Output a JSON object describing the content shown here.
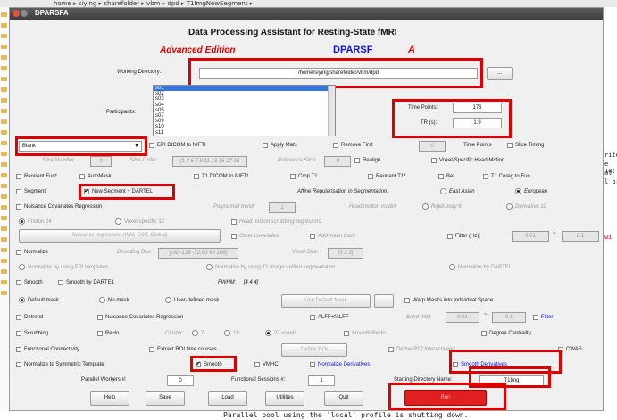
{
  "pathbar": {
    "path": [
      "home",
      "siying",
      "sharefolder",
      "vbm",
      "dpd",
      "T1ImgNewSegment"
    ]
  },
  "window": {
    "title": "DPARSFA"
  },
  "header": {
    "title": "Data Processing Assistant for Resting-State fMRI",
    "subtitle": "Advanced Edition",
    "brand": "DPARSF",
    "brand_suffix": "A"
  },
  "working_dir": {
    "label": "Working Directory:",
    "value": "/home/siying/sharefolder/vbm/dpd",
    "browse": "..."
  },
  "participants": {
    "label": "Participants:",
    "items": [
      "s01",
      "s02",
      "s03",
      "s04",
      "s05",
      "s07",
      "s09",
      "s10",
      "s11"
    ],
    "selected": "s01"
  },
  "time_points": {
    "label": "Time Points:",
    "value": "176"
  },
  "tr": {
    "label": "TR (s):",
    "value": "1.9"
  },
  "template_select": {
    "value": "Blank",
    "arrow": "▼"
  },
  "row_epi": {
    "epi_dicom": "EPI DICOM to NIFTI",
    "apply_mats": "Apply Mats",
    "remove_first": "Remove First",
    "remove_first_value": "0",
    "time_points": "Time Points",
    "slice_timing": "Slice Timing"
  },
  "row_slice": {
    "slice_number": "Slice Number",
    "slice_number_value": "0",
    "slice_order": "Slice Order:",
    "slice_order_value": "[1 3 5 7 9 11 13 15 17 15",
    "reference_slice": "Reference Slice:",
    "reference_slice_value": "0",
    "realign": "Realign",
    "voxel_specific": "Voxel-Specific Head Motion"
  },
  "row_reorient": {
    "reorient_fun": "Reorient Fun*",
    "automask": "AutoMask",
    "t1_dicom": "T1 DICOM to NIFTI",
    "crop_t1": "Crop T1",
    "reorient_t1": "Reorient T1*",
    "bet": "Bet",
    "t1_coreg": "T1 Coreg to Fun"
  },
  "row_segment": {
    "segment": "Segment",
    "new_segment": "New Segment + DARTEL",
    "affine_label": "Affine Regularisation in Segmentation:",
    "east_asian": "East Asian",
    "european": "European"
  },
  "row_nuisance": {
    "nuisance": "Nuisance Covariates Regression",
    "poly_trend": "Polynomial trend:",
    "poly_value": "1",
    "head_motion": "Head motion model:",
    "rigid": "Rigid-body 6",
    "derivative": "Derivative 12"
  },
  "row_friston": {
    "friston": "Friston 24",
    "voxel_12": "Voxel-specific 12",
    "scrubbing_regressors": "Head motion scrubbing regressors"
  },
  "row_regressors": {
    "regressors_btn": "Nuisance regressors (WM, CSF, Global)",
    "other_cov": "Other covariates",
    "add_mean": "Add mean back",
    "filter": "Filter (Hz):",
    "filter_low": "0.01",
    "tilde": "~",
    "filter_high": "0.1"
  },
  "row_normalize": {
    "normalize": "Normalize",
    "bbox_label": "Bounding Box:",
    "bbox_value": "[-90 -126 -72;90 90 108]",
    "voxel_size_label": "Voxel Size:",
    "voxel_size_value": "[3 3 3]"
  },
  "row_norm_opts": {
    "epi_templates": "Normalize by using EPI templates",
    "t1_unified": "Normalize by using T1 image unified segmentation",
    "by_dartel": "Normalize by DARTEL"
  },
  "row_smooth": {
    "smooth": "Smooth",
    "smooth_dartel": "Smooth by DARTEL",
    "fwhm_label": "FWHM:",
    "fwhm_value": "[4 4 4]"
  },
  "row_mask": {
    "default_mask": "Default mask",
    "no_mask": "No mask",
    "user_mask": "User-defined mask",
    "use_default_btn": "Use Default Mask",
    "browse": "...",
    "warp": "Warp Masks into Individual Space"
  },
  "row_detrend": {
    "detrend": "Detrend",
    "nuisance_reg": "Nuisance Covariates Regression",
    "alff": "ALFF+fALFF",
    "band": "Band (Hz):",
    "band_low": "0.01",
    "tilde": "~",
    "band_high": "0.1",
    "filter": "Filter"
  },
  "row_scrubbing": {
    "scrubbing": "Scrubbing",
    "reho": "ReHo",
    "cluster": "Cluster:",
    "c7": "7",
    "c19": "19",
    "c27": "27 voxels",
    "smooth_reho": "Smooth ReHo",
    "degree": "Degree Centrality"
  },
  "row_fc": {
    "fc": "Functional Connectivity",
    "extract_roi": "Extract ROI time courses",
    "define_roi": "Define ROI",
    "define_roi_inter": "Define ROI Interactively*",
    "cwas": "CWAS"
  },
  "row_sym": {
    "normalize_sym": "Normalize to Symmetric Template",
    "smooth": "Smooth",
    "vmhc": "VMHC",
    "normalize_deriv": "Normalize Derivatives",
    "smooth_deriv": "Smooth Derivatives"
  },
  "row_workers": {
    "parallel": "Parallel Workers #:",
    "parallel_value": "0",
    "sessions": "Functional Sessions #:",
    "sessions_value": "1",
    "start_dir": "Starting Directory Name:",
    "start_dir_value": "T1Img"
  },
  "buttons": {
    "help": "Help",
    "save": "Save",
    "load": "Load",
    "utilities": "Utilities",
    "quit": "Quit",
    "run": "Run"
  },
  "console": {
    "bottom_line": "Parallel pool using the 'local' profile is shutting down.",
    "right_fragments": [
      "rite",
      "e 14:",
      "at",
      "l_pr",
      "wi"
    ]
  },
  "colors": {
    "highlight_red": "#e00000",
    "run_red": "#e02020",
    "title_red": "#e00000",
    "brand_blue": "#1010e0"
  }
}
